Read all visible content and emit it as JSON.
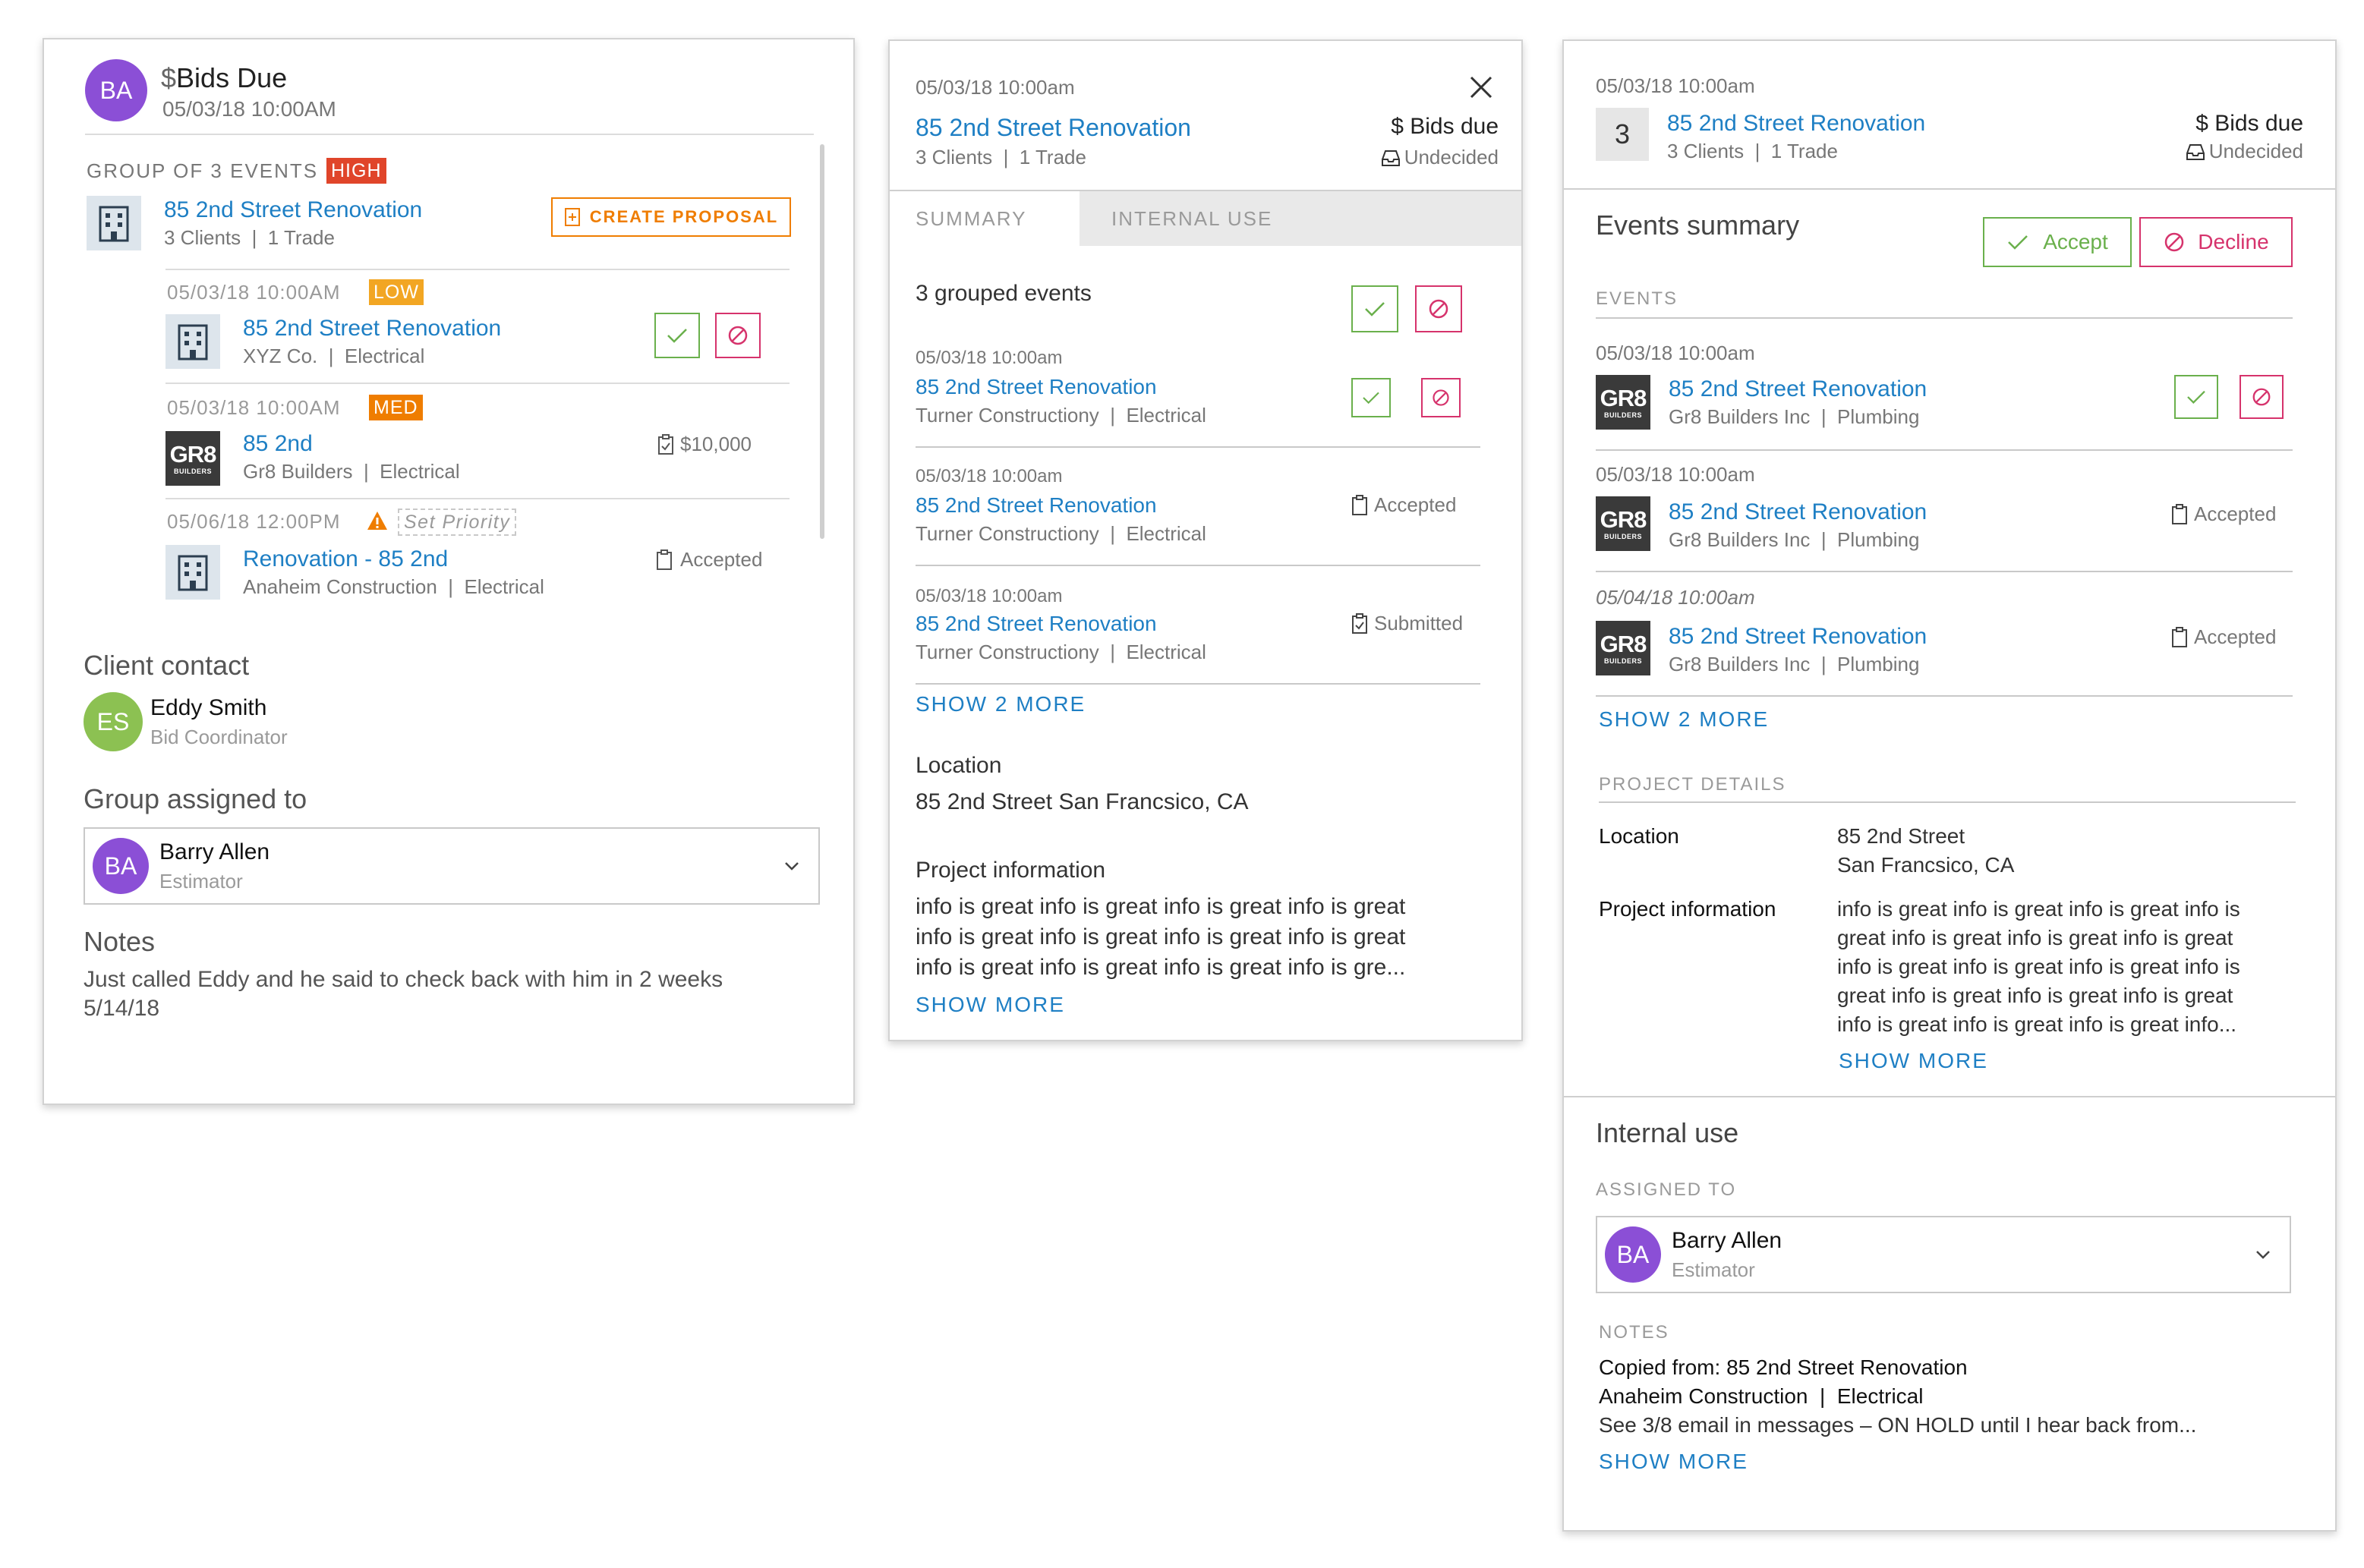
{
  "colors": {
    "link": "#1e7fc4",
    "high": "#e0452a",
    "low": "#f2a623",
    "med": "#ef7d00",
    "accept": "#6ab04c",
    "decline": "#d6336c",
    "avatar_purple": "#8b4fd6",
    "avatar_green": "#8cc152"
  },
  "p1": {
    "avatar": "BA",
    "title_icon": "$",
    "title": "Bids Due",
    "datetime": "05/03/18 10:00AM",
    "group_label": "GROUP OF 3 EVENTS",
    "group_badge": "HIGH",
    "group_project": "85 2nd Street Renovation",
    "group_meta": "3 Clients  |  1 Trade",
    "create_proposal": "CREATE PROPOSAL",
    "events": [
      {
        "date": "05/03/18 10:00AM",
        "badge": "LOW",
        "title": "85 2nd Street Renovation",
        "meta": "XYZ Co.  |  Electrical",
        "logo": "building"
      },
      {
        "date": "05/03/18 10:00AM",
        "badge": "MED",
        "title": "85 2nd",
        "meta": "Gr8 Builders  |  Electrical",
        "logo": "gr8",
        "amount": "$10,000"
      },
      {
        "date": "05/06/18 12:00PM",
        "set_priority": "Set Priority",
        "title": "Renovation - 85 2nd",
        "meta": "Anaheim Construction  |  Electrical",
        "logo": "building",
        "status": "Accepted"
      }
    ],
    "client_contact_label": "Client contact",
    "contact_initials": "ES",
    "contact_name": "Eddy Smith",
    "contact_role": "Bid Coordinator",
    "group_assigned_label": "Group assigned to",
    "assignee_initials": "BA",
    "assignee_name": "Barry Allen",
    "assignee_role": "Estimator",
    "notes_label": "Notes",
    "notes_line1": "Just called Eddy and he said to check back with him in 2 weeks",
    "notes_line2": "5/14/18"
  },
  "p2": {
    "datetime": "05/03/18 10:00am",
    "title": "85 2nd Street Renovation",
    "meta": "3 Clients  |  1 Trade",
    "status_icon": "$",
    "status": "Bids due",
    "substatus": "Undecided",
    "tab_summary": "SUMMARY",
    "tab_internal": "INTERNAL USE",
    "grouped_label": "3 grouped events",
    "events": [
      {
        "date": "05/03/18 10:00am",
        "title": "85 2nd Street Renovation",
        "meta": "Turner Constructiony  |  Electrical"
      },
      {
        "date": "05/03/18 10:00am",
        "title": "85 2nd Street Renovation",
        "meta": "Turner Constructiony  |  Electrical",
        "status": "Accepted"
      },
      {
        "date": "05/03/18 10:00am",
        "title": "85 2nd Street Renovation",
        "meta": "Turner Constructiony  |  Electrical",
        "status": "Submitted"
      }
    ],
    "show_more_events": "SHOW 2 MORE",
    "location_label": "Location",
    "location_value": "85 2nd Street San Francsico, CA",
    "project_info_label": "Project information",
    "project_info_lines": [
      "info is great info is great info is great info is great",
      "info is great info is great info is great info is great",
      "info is great info is great info is great info is gre..."
    ],
    "show_more": "SHOW MORE"
  },
  "p3": {
    "datetime": "05/03/18 10:00am",
    "count": "3",
    "title": "85 2nd Street Renovation",
    "meta": "3 Clients  |  1 Trade",
    "status_icon": "$",
    "status": "Bids due",
    "substatus": "Undecided",
    "events_summary_label": "Events summary",
    "accept": "Accept",
    "decline": "Decline",
    "events_label": "EVENTS",
    "events": [
      {
        "date": "05/03/18 10:00am",
        "title": "85 2nd Street Renovation",
        "meta": "Gr8 Builders Inc  |  Plumbing"
      },
      {
        "date": "05/03/18 10:00am",
        "title": "85 2nd Street Renovation",
        "meta": "Gr8 Builders Inc  |  Plumbing",
        "status": "Accepted"
      },
      {
        "date": "05/04/18 10:00am",
        "title": "85 2nd Street Renovation",
        "meta": "Gr8 Builders Inc  |  Plumbing",
        "status": "Accepted"
      }
    ],
    "show_more_events": "SHOW 2 MORE",
    "project_details_label": "PROJECT DETAILS",
    "location_label": "Location",
    "location_line1": "85 2nd Street",
    "location_line2": "San Francsico, CA",
    "project_info_label": "Project information",
    "project_info_lines": [
      "info is great info is great info is great info is",
      "great info is great info is great info is great",
      "info is great info is great info is great info is",
      "great info is great info is great info is great",
      "info is great info is great info is great info..."
    ],
    "show_more": "SHOW MORE",
    "internal_use_label": "Internal use",
    "assigned_to_label": "ASSIGNED TO",
    "assignee_initials": "BA",
    "assignee_name": "Barry Allen",
    "assignee_role": "Estimator",
    "notes_label": "NOTES",
    "notes_line1": "Copied from: 85 2nd Street Renovation",
    "notes_line2": "Anaheim Construction  |  Electrical",
    "notes_line3": "See 3/8 email in messages – ON HOLD until I hear back from...",
    "notes_show_more": "SHOW MORE"
  }
}
